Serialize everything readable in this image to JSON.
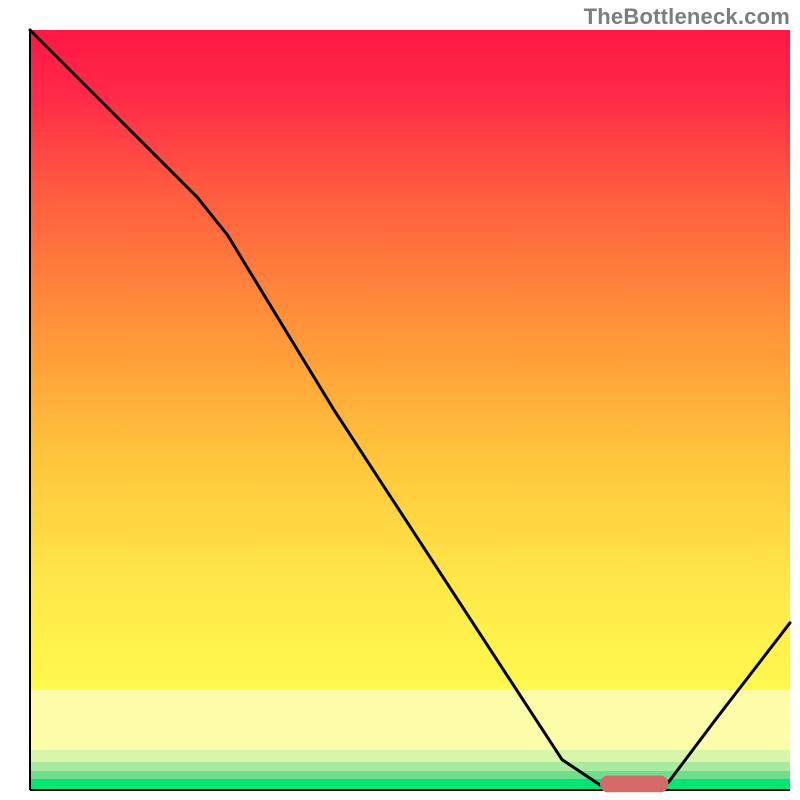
{
  "watermark": "TheBottleneck.com",
  "colors": {
    "curve": "#000000",
    "marker": "#d46a6a",
    "green_base": "#00e676"
  },
  "chart_data": {
    "type": "line",
    "title": "",
    "xlabel": "",
    "ylabel": "",
    "xlim": [
      0,
      100
    ],
    "ylim": [
      0,
      100
    ],
    "grid": false,
    "legend": false,
    "series": [
      {
        "name": "curve",
        "x": [
          0,
          10,
          22,
          26,
          40,
          55,
          70,
          76,
          80,
          84,
          90,
          100
        ],
        "values": [
          100,
          90,
          78,
          73,
          50,
          27,
          4,
          0,
          0,
          1,
          9,
          22
        ]
      }
    ],
    "marker": {
      "x_start": 75,
      "x_end": 84,
      "y": 0,
      "thickness_pct": 2.2
    },
    "bands_y_pct": {
      "pale_yellow_top": 86.8,
      "green1_top": 94.7,
      "green2_top": 96.3,
      "green3_top": 97.5,
      "green_bottom_top": 98.6
    }
  }
}
